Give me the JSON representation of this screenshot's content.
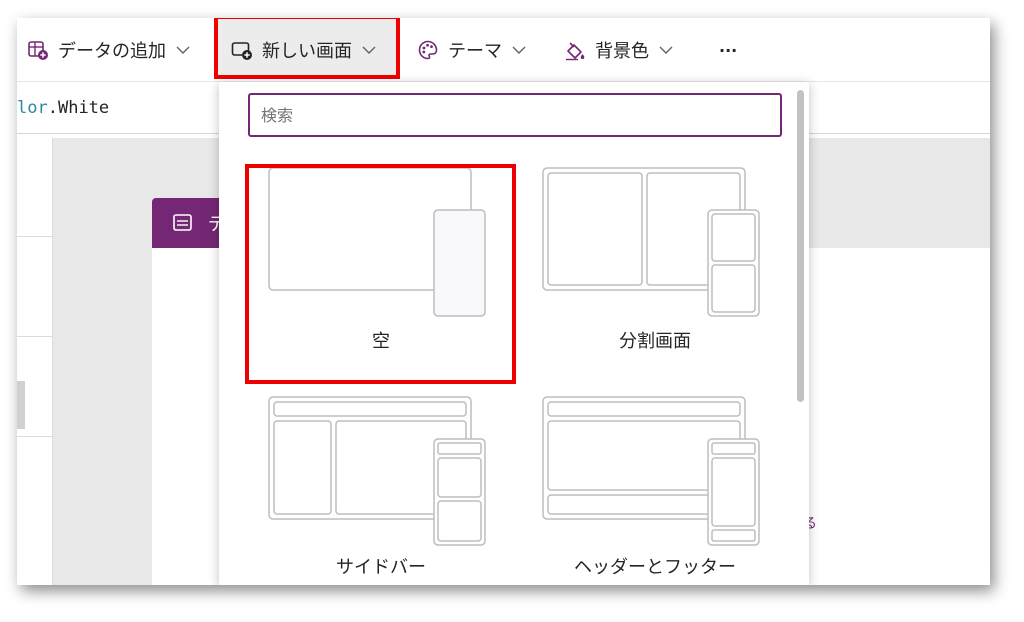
{
  "toolbar": {
    "add_data": "データの追加",
    "new_screen": "新しい画面",
    "theme": "テーマ",
    "background": "背景色",
    "more": "···"
  },
  "formula": {
    "prefix": "lor",
    "dot": ".",
    "value": "White"
  },
  "canvas": {
    "tab_label_fragment": "デ",
    "link_fragment": "る"
  },
  "dropdown": {
    "search_placeholder": "検索",
    "layouts": [
      {
        "label": "空",
        "selected": true
      },
      {
        "label": "分割画面",
        "selected": false
      },
      {
        "label": "サイドバー",
        "selected": false
      },
      {
        "label": "ヘッダーとフッター",
        "selected": false
      }
    ]
  },
  "colors": {
    "accent": "#742774",
    "highlight": "#ee0000"
  }
}
